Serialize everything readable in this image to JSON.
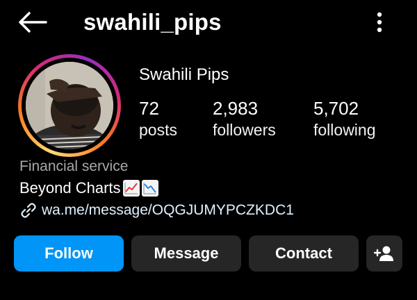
{
  "header": {
    "username": "swahili_pips",
    "back_icon": "arrow-left-icon",
    "more_icon": "more-vertical-icon"
  },
  "profile": {
    "display_name": "Swahili Pips",
    "stats": [
      {
        "value": "72",
        "label": "posts"
      },
      {
        "value": "2,983",
        "label": "followers"
      },
      {
        "value": "5,702",
        "label": "following"
      }
    ],
    "category": "Financial service",
    "bio": "Beyond Charts",
    "bio_emojis": [
      "chart-increasing-icon",
      "chart-decreasing-icon"
    ],
    "link": "wa.me/message/OQGJUMYPCZKDC1",
    "link_icon": "link-icon"
  },
  "actions": {
    "follow_label": "Follow",
    "message_label": "Message",
    "contact_label": "Contact",
    "add_user_icon": "add-user-icon"
  },
  "colors": {
    "background": "#000000",
    "primary_button": "#0095f6",
    "secondary_button": "#262626",
    "secondary_text": "#a8a8a8",
    "link_text": "#e0f1ff"
  }
}
